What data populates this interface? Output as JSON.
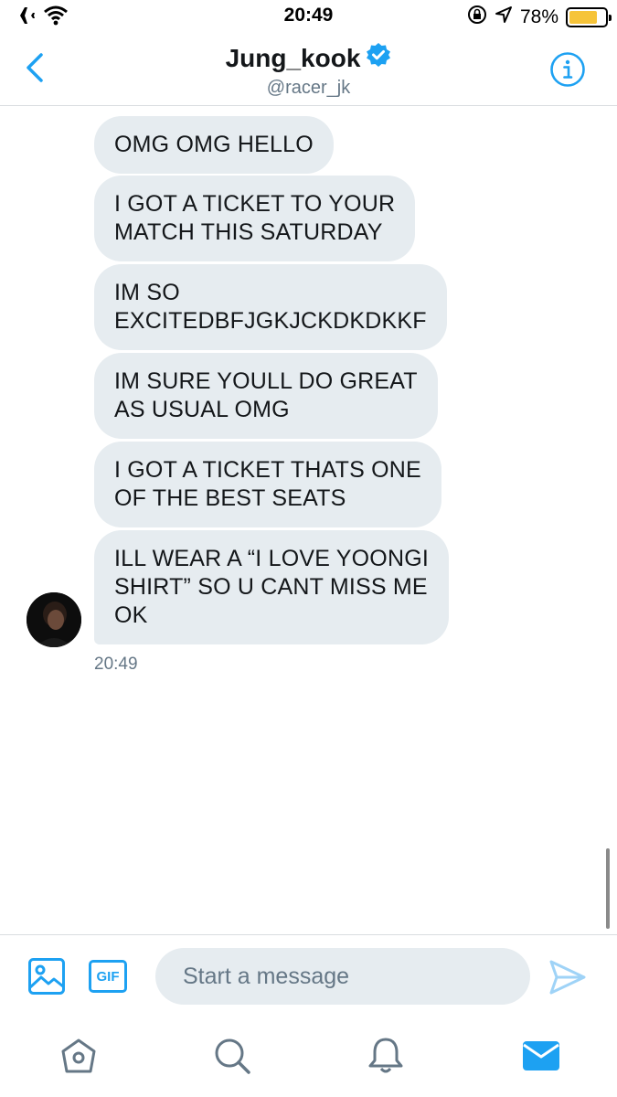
{
  "status_bar": {
    "time": "20:49",
    "battery_percent": "78%",
    "battery_level": 0.78,
    "battery_color": "#f6c43a"
  },
  "header": {
    "display_name": "Jung_kook",
    "handle": "@racer_jk",
    "verified": true,
    "accent": "#1da1f2"
  },
  "messages": [
    {
      "text_lines": [
        "OMG OMG HELLO"
      ]
    },
    {
      "text_lines": [
        "I GOT A TICKET TO YOUR",
        "MATCH THIS SATURDAY"
      ]
    },
    {
      "text_lines": [
        "IM SO",
        "EXCITEDBFJGKJCKDKDKKF"
      ]
    },
    {
      "text_lines": [
        "IM SURE YOULL DO GREAT",
        "AS USUAL OMG"
      ]
    },
    {
      "text_lines": [
        "I GOT A TICKET THATS ONE",
        "OF THE BEST SEATS"
      ]
    },
    {
      "text_lines": [
        "ILL WEAR A “I LOVE YOONGI",
        "SHIRT” SO U CANT MISS ME",
        "OK"
      ]
    }
  ],
  "message_timestamp": "20:49",
  "composer": {
    "placeholder": "Start a message",
    "gif_label": "GIF"
  },
  "tab_bar": {
    "items": [
      "home-icon",
      "search-icon",
      "notifications-icon",
      "messages-icon"
    ],
    "active": "messages-icon"
  }
}
